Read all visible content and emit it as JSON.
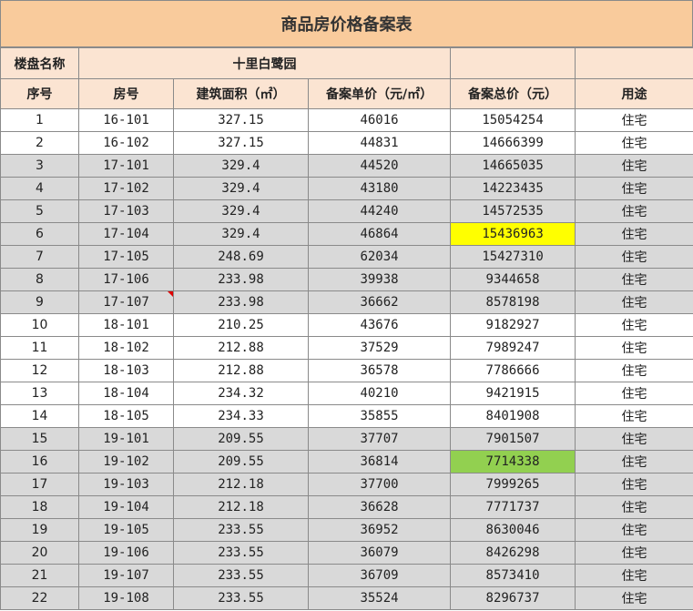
{
  "title": "商品房价格备案表",
  "project": {
    "label": "楼盘名称",
    "name": "十里白鹭园"
  },
  "headers": [
    "序号",
    "房号",
    "建筑面积（㎡）",
    "备案单价（元/㎡）",
    "备案总价（元）",
    "用途"
  ],
  "rows": [
    [
      "1",
      "16-101",
      "327.15",
      "46016",
      "15054254",
      "住宅"
    ],
    [
      "2",
      "16-102",
      "327.15",
      "44831",
      "14666399",
      "住宅"
    ],
    [
      "3",
      "17-101",
      "329.4",
      "44520",
      "14665035",
      "住宅"
    ],
    [
      "4",
      "17-102",
      "329.4",
      "43180",
      "14223435",
      "住宅"
    ],
    [
      "5",
      "17-103",
      "329.4",
      "44240",
      "14572535",
      "住宅"
    ],
    [
      "6",
      "17-104",
      "329.4",
      "46864",
      "15436963",
      "住宅"
    ],
    [
      "7",
      "17-105",
      "248.69",
      "62034",
      "15427310",
      "住宅"
    ],
    [
      "8",
      "17-106",
      "233.98",
      "39938",
      "9344658",
      "住宅"
    ],
    [
      "9",
      "17-107",
      "233.98",
      "36662",
      "8578198",
      "住宅"
    ],
    [
      "10",
      "18-101",
      "210.25",
      "43676",
      "9182927",
      "住宅"
    ],
    [
      "11",
      "18-102",
      "212.88",
      "37529",
      "7989247",
      "住宅"
    ],
    [
      "12",
      "18-103",
      "212.88",
      "36578",
      "7786666",
      "住宅"
    ],
    [
      "13",
      "18-104",
      "234.32",
      "40210",
      "9421915",
      "住宅"
    ],
    [
      "14",
      "18-105",
      "234.33",
      "35855",
      "8401908",
      "住宅"
    ],
    [
      "15",
      "19-101",
      "209.55",
      "37707",
      "7901507",
      "住宅"
    ],
    [
      "16",
      "19-102",
      "209.55",
      "36814",
      "7714338",
      "住宅"
    ],
    [
      "17",
      "19-103",
      "212.18",
      "37700",
      "7999265",
      "住宅"
    ],
    [
      "18",
      "19-104",
      "212.18",
      "36628",
      "7771737",
      "住宅"
    ],
    [
      "19",
      "19-105",
      "233.55",
      "36952",
      "8630046",
      "住宅"
    ],
    [
      "20",
      "19-106",
      "233.55",
      "36079",
      "8426298",
      "住宅"
    ],
    [
      "21",
      "19-107",
      "233.55",
      "36709",
      "8573410",
      "住宅"
    ],
    [
      "22",
      "19-108",
      "233.55",
      "35524",
      "8296737",
      "住宅"
    ]
  ],
  "row_shading": [
    "w",
    "w",
    "g",
    "g",
    "g",
    "g",
    "g",
    "g",
    "g",
    "w",
    "w",
    "w",
    "w",
    "w",
    "g",
    "g",
    "g",
    "g",
    "g",
    "g",
    "g",
    "g"
  ],
  "highlights": [
    {
      "row": 6,
      "column": 5,
      "color": "#ffff00"
    },
    {
      "row": 16,
      "column": 5,
      "color": "#92d050"
    }
  ],
  "colors": {
    "title_bg": "#f9cb9c",
    "header_bg": "#fbe4d2",
    "shaded_row": "#d9d9d9",
    "border": "#8a8a8a",
    "comment_marker": "#e00000"
  }
}
